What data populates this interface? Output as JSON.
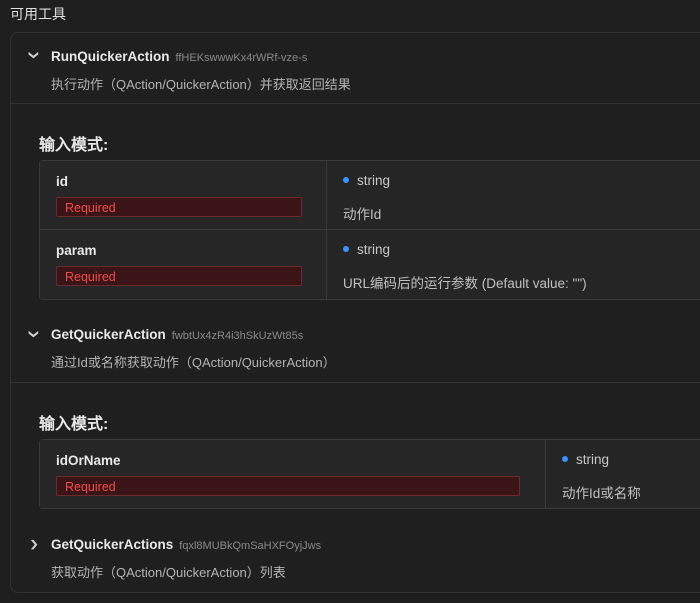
{
  "section_title": "可用工具",
  "schema_label": "输入模式:",
  "required_label": "Required",
  "tools": [
    {
      "name": "RunQuickerAction",
      "id": "ffHEKswwwKx4rWRf-vze-s",
      "description": "执行动作（QAction/QuickerAction）并获取返回结果",
      "expanded": true,
      "params": [
        {
          "name": "id",
          "type": "string",
          "description": "动作Id"
        },
        {
          "name": "param",
          "type": "string",
          "description": "URL编码后的运行参数 (Default value: \"\")"
        }
      ]
    },
    {
      "name": "GetQuickerAction",
      "id": "fwbtUx4zR4i3hSkUzWt85s",
      "description": "通过Id或名称获取动作（QAction/QuickerAction）",
      "expanded": true,
      "params": [
        {
          "name": "idOrName",
          "type": "string",
          "description": "动作Id或名称"
        }
      ]
    },
    {
      "name": "GetQuickerActions",
      "id": "fqxl8MUBkQmSaHXFOyjJws",
      "description": "获取动作（QAction/QuickerAction）列表",
      "expanded": false
    }
  ]
}
